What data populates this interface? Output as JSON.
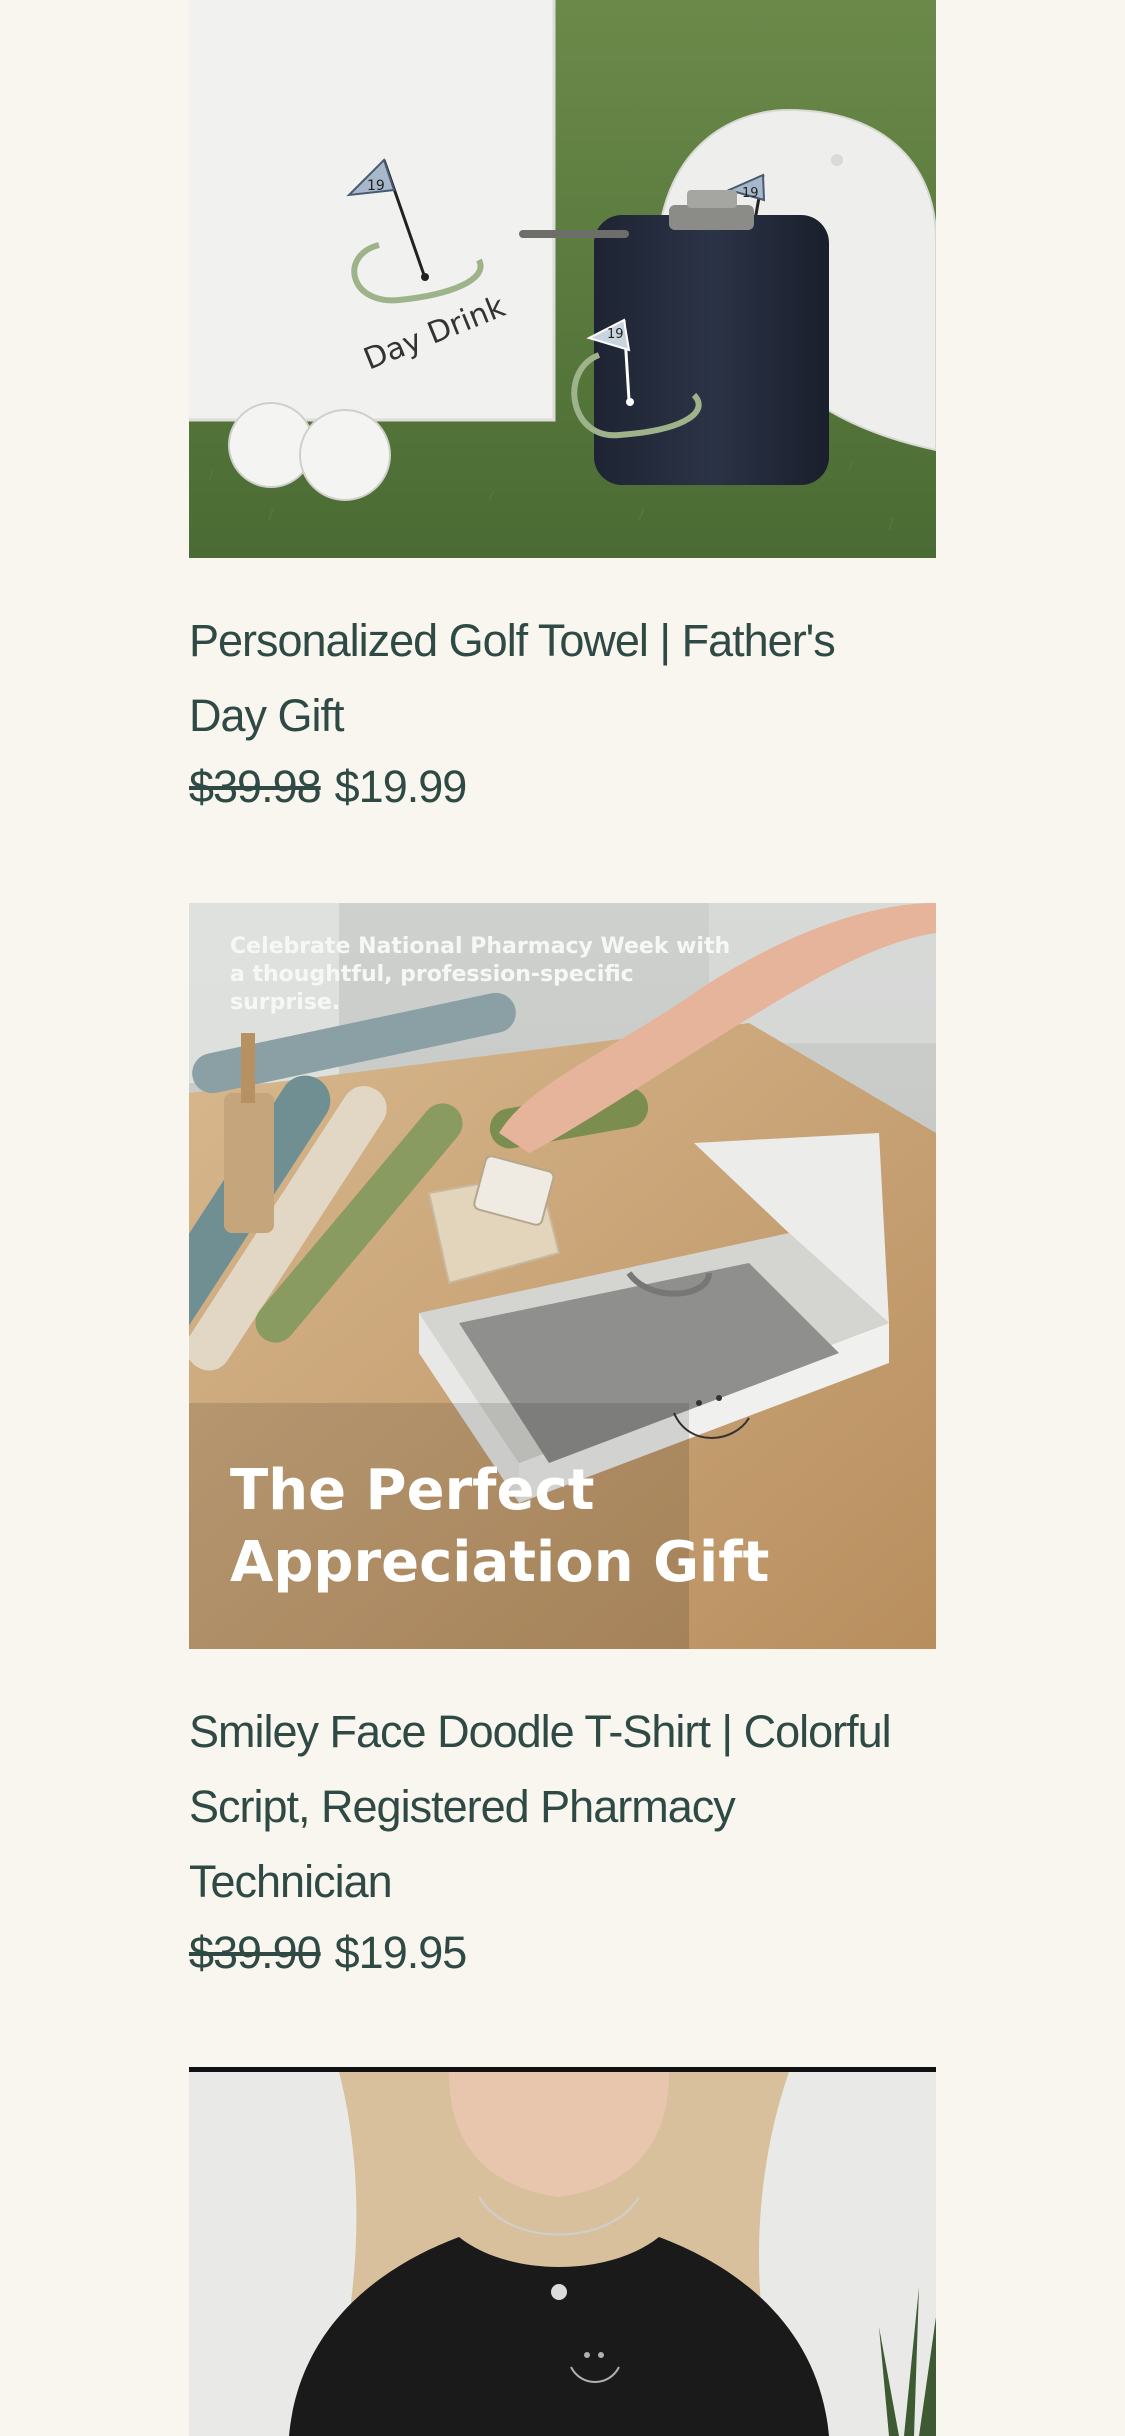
{
  "products": [
    {
      "title_line1": "Personalized Golf Towel | Father's",
      "title_line2": "Day Gift",
      "price_original": "$39.98",
      "price_sale": "$19.99",
      "image": {
        "towel_text": "Day Drink",
        "flag_number": "19",
        "flask_flag_number": "19",
        "cap_flag_number": "19"
      }
    },
    {
      "title_line1": "Smiley Face Doodle T-Shirt | Colorful",
      "title_line2": "Script, Registered Pharmacy",
      "title_line3": "Technician",
      "price_original": "$39.90",
      "price_sale": "$19.95",
      "image": {
        "caption_small": "Celebrate National Pharmacy Week with a thoughtful, profession-specific surprise.",
        "caption_big_line1": "The Perfect",
        "caption_big_line2": "Appreciation Gift"
      }
    },
    {
      "image_alt": "black-tshirt-model"
    }
  ]
}
